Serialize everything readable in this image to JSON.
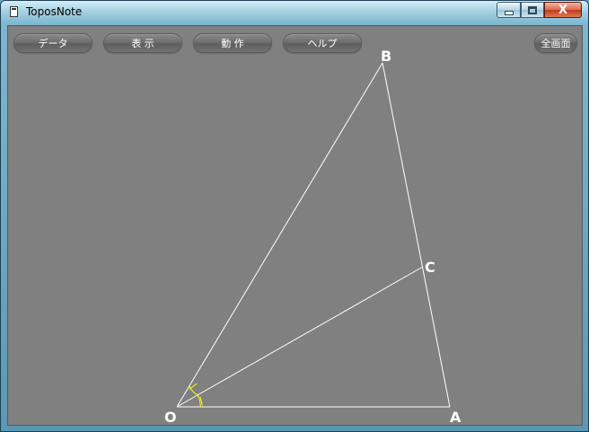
{
  "window": {
    "title": "ToposNote",
    "controls": {
      "minimize": "minimize",
      "maximize": "maximize",
      "close": "X"
    }
  },
  "toolbar": {
    "data_label": "データ",
    "view_label": "表 示",
    "action_label": "動 作",
    "help_label": "ヘルプ",
    "fullscreen_label": "全画面"
  },
  "figure": {
    "points": {
      "O": "O",
      "A": "A",
      "B": "B",
      "C": "C"
    },
    "colors": {
      "background": "#808080",
      "lines": "#ffffff",
      "angle_marks": "#ffff00",
      "labels": "#ffffff"
    }
  }
}
